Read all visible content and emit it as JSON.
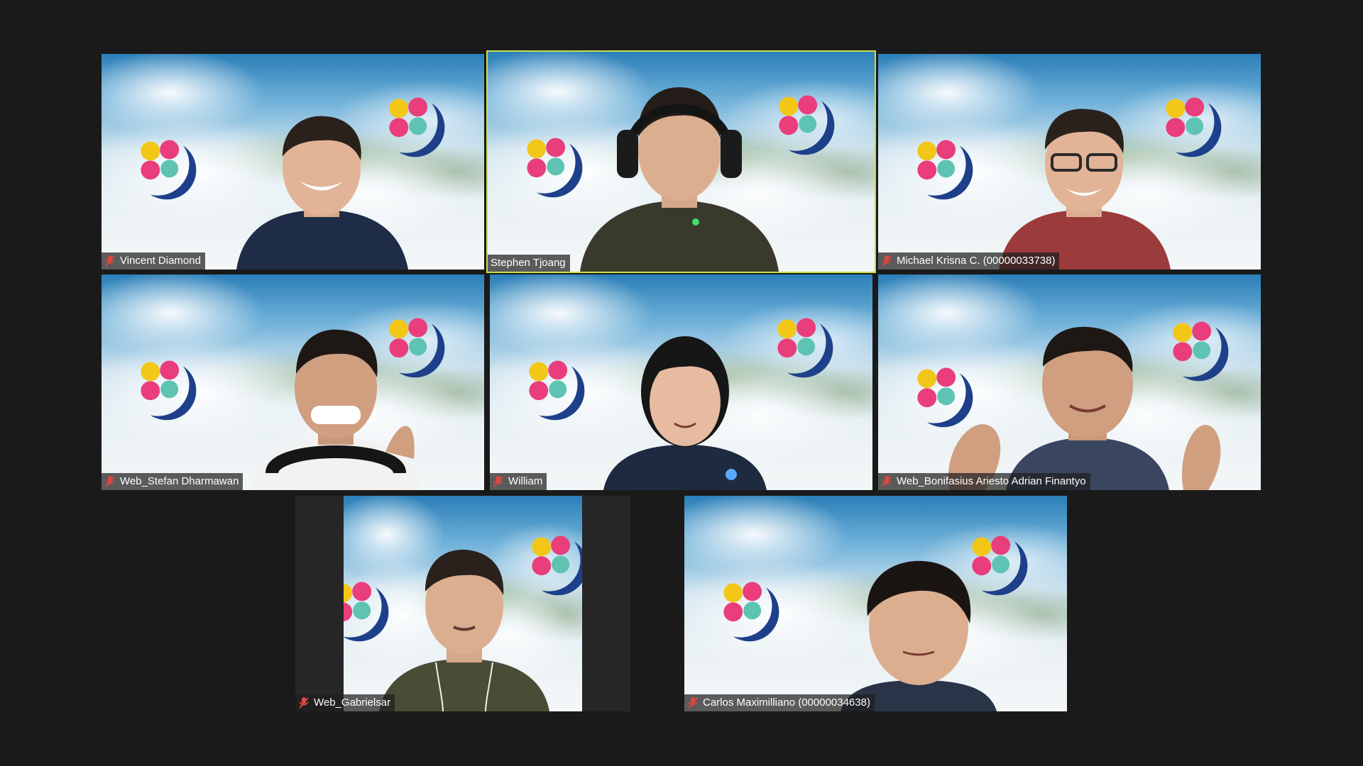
{
  "meeting": {
    "layout": "gallery-view",
    "accent_color": "#c8e04a",
    "muted_icon": "muted-mic-icon",
    "muted_color": "#e0463c"
  },
  "participants": [
    {
      "name": "Vincent Diamond",
      "muted": true,
      "active_speaker": false
    },
    {
      "name": "Stephen Tjoang",
      "muted": false,
      "active_speaker": true
    },
    {
      "name": "Michael Krisna C. (00000033738)",
      "muted": true,
      "active_speaker": false
    },
    {
      "name": "Web_Stefan Dharmawan",
      "muted": true,
      "active_speaker": false
    },
    {
      "name": "William",
      "muted": true,
      "active_speaker": false
    },
    {
      "name": "Web_Bonifasius Ariesto Adrian Finantyo",
      "muted": true,
      "active_speaker": false
    },
    {
      "name": "Web_Gabrielsar",
      "muted": true,
      "active_speaker": false
    },
    {
      "name": "Carlos Maximilliano (00000034638)",
      "muted": true,
      "active_speaker": false
    }
  ]
}
